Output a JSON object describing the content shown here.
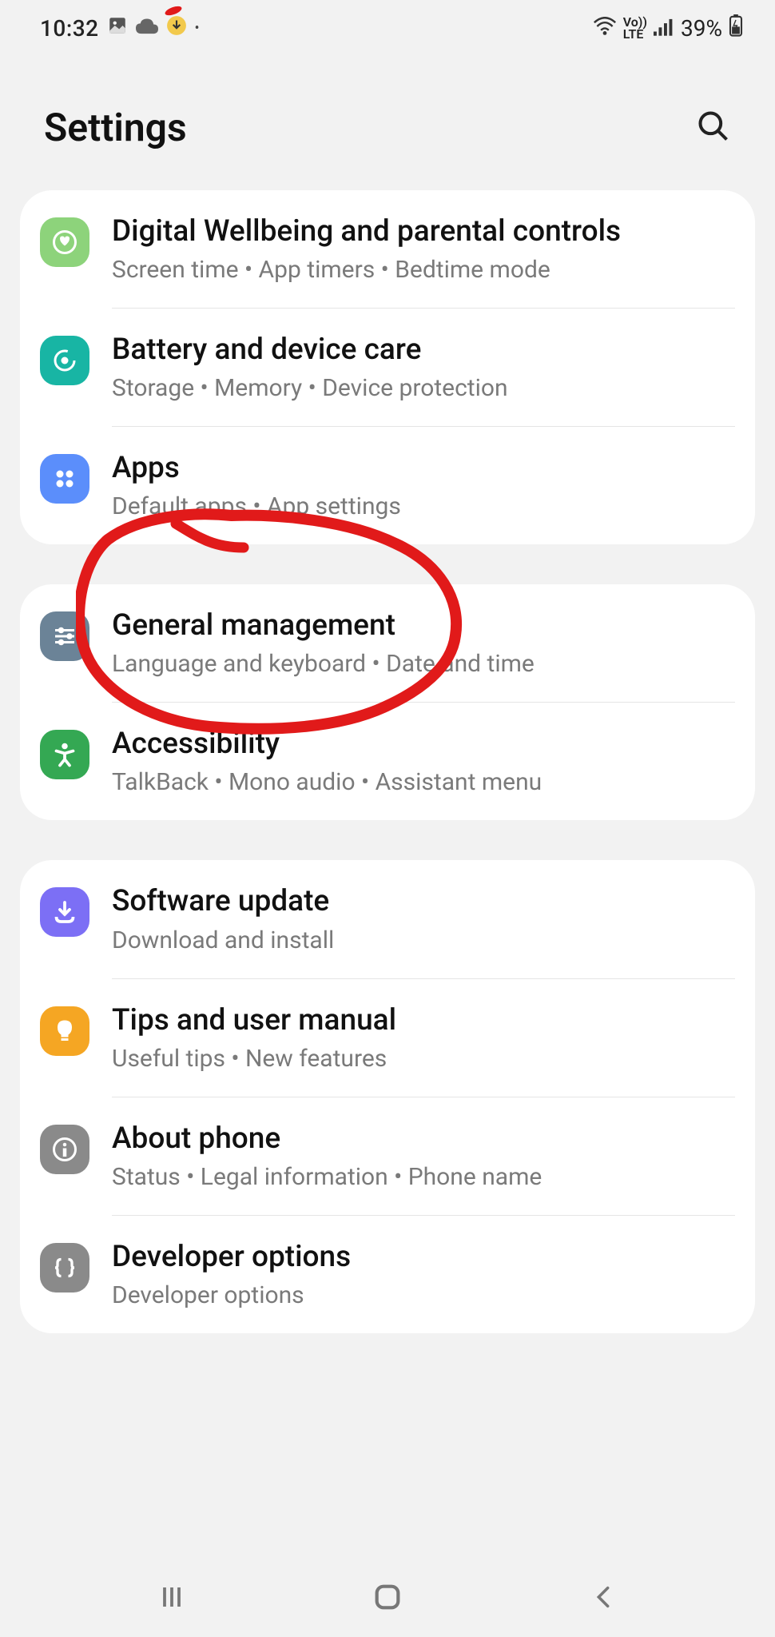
{
  "status": {
    "time": "10:32",
    "battery": "39%",
    "network_label": "LTE"
  },
  "header": {
    "title": "Settings"
  },
  "groups": [
    {
      "items": [
        {
          "key": "wellbeing",
          "title": "Digital Wellbeing and parental controls",
          "sub": "Screen time  •  App timers  •  Bedtime mode"
        },
        {
          "key": "battery",
          "title": "Battery and device care",
          "sub": "Storage  •  Memory  •  Device protection"
        },
        {
          "key": "apps",
          "title": "Apps",
          "sub": "Default apps  •  App settings"
        }
      ]
    },
    {
      "items": [
        {
          "key": "general",
          "title": "General management",
          "sub": "Language and keyboard  •  Date and time"
        },
        {
          "key": "accessibility",
          "title": "Accessibility",
          "sub": "TalkBack  •  Mono audio  •  Assistant menu"
        }
      ]
    },
    {
      "items": [
        {
          "key": "software",
          "title": "Software update",
          "sub": "Download and install"
        },
        {
          "key": "tips",
          "title": "Tips and user manual",
          "sub": "Useful tips  •  New features"
        },
        {
          "key": "about",
          "title": "About phone",
          "sub": "Status  •  Legal information  •  Phone name"
        },
        {
          "key": "dev",
          "title": "Developer options",
          "sub": "Developer options"
        }
      ]
    }
  ]
}
